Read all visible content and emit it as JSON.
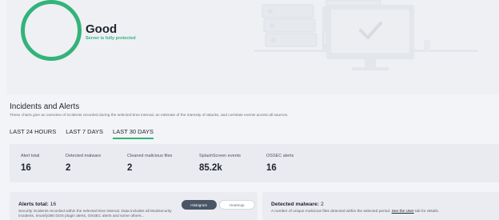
{
  "status": {
    "title": "Good",
    "subtitle": "Server is fully protected",
    "color": "#33b37a"
  },
  "incidents": {
    "title": "Incidents and Alerts",
    "description": "These charts give an overview of incidents recorded during the selected time interval, an estimate of the intensity of attacks, and correlate events across all sources.",
    "tabs": [
      {
        "label": "LAST 24 HOURS",
        "active": false
      },
      {
        "label": "LAST 7 DAYS",
        "active": false
      },
      {
        "label": "LAST 30 DAYS",
        "active": true
      }
    ]
  },
  "stats": [
    {
      "label": "Alert total",
      "value": "16"
    },
    {
      "label": "Detected malware",
      "value": "2"
    },
    {
      "label": "Cleaned malicious files",
      "value": "2"
    },
    {
      "label": "SplashScreen events",
      "value": "85.2k"
    },
    {
      "label": "OSSEC alerts",
      "value": "16"
    }
  ],
  "alerts_card": {
    "title_label": "Alerts total:",
    "title_value": "16",
    "description": "Security incidents recorded within the selected time interval. Data includes all ModSecurity incidents, Imunify360 DOS plugin alerts, OSSEC alerts and some others...",
    "toggle_on": "Histogram",
    "toggle_off": "Heatmap"
  },
  "malware_card": {
    "title_label": "Detected malware:",
    "title_value": "2",
    "description_before": "A number of unique malicious files detected within the selected period.",
    "link": "See the User",
    "description_after": "tab for details."
  }
}
